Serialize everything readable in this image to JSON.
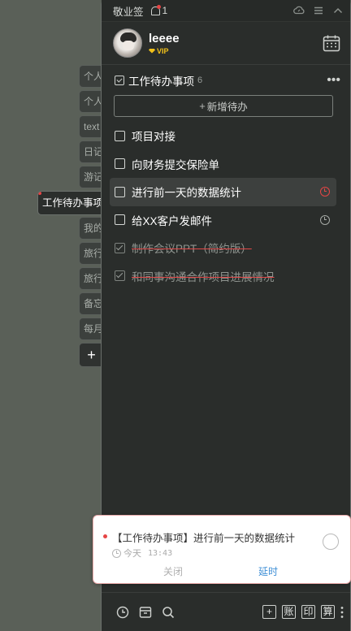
{
  "sidebar_tabs": [
    {
      "label": "个人"
    },
    {
      "label": "个人"
    },
    {
      "label": "text"
    },
    {
      "label": "日记"
    },
    {
      "label": "游记"
    },
    {
      "label": "工作待办事项"
    },
    {
      "label": "我的"
    },
    {
      "label": "旅行"
    },
    {
      "label": "旅行"
    },
    {
      "label": "备忘"
    },
    {
      "label": "每月"
    },
    {
      "label": "+"
    }
  ],
  "topbar": {
    "brand": "敬业签",
    "notification_count": "1"
  },
  "user": {
    "name": "leeee",
    "badge": "VIP"
  },
  "list": {
    "title": "工作待办事项",
    "count": "6",
    "more": "•••",
    "add_label": "新增待办",
    "items": [
      {
        "text": "项目对接",
        "done": false
      },
      {
        "text": "向财务提交保险单",
        "done": false
      },
      {
        "text": "进行前一天的数据统计",
        "done": false
      },
      {
        "text": "给XX客户发邮件",
        "done": false
      },
      {
        "text": "制作会议PPT（简约版）",
        "done": true
      },
      {
        "text": "和同事沟通合作项目进展情况",
        "done": true
      }
    ]
  },
  "notification": {
    "title": "【工作待办事项】进行前一天的数据统计",
    "day": "今天",
    "time": "13:43",
    "close_label": "关闭",
    "delay_label": "延时"
  },
  "bottombar": {
    "btn_add": "+",
    "btn_account": "账",
    "btn_print": "印",
    "btn_calc": "算"
  },
  "colors": {
    "panel_bg": "#2a2d2b",
    "desktop_bg": "#5a6058",
    "accent_red": "#e64545",
    "vip_gold": "#f2c11a",
    "link_blue": "#3f8fd6"
  }
}
